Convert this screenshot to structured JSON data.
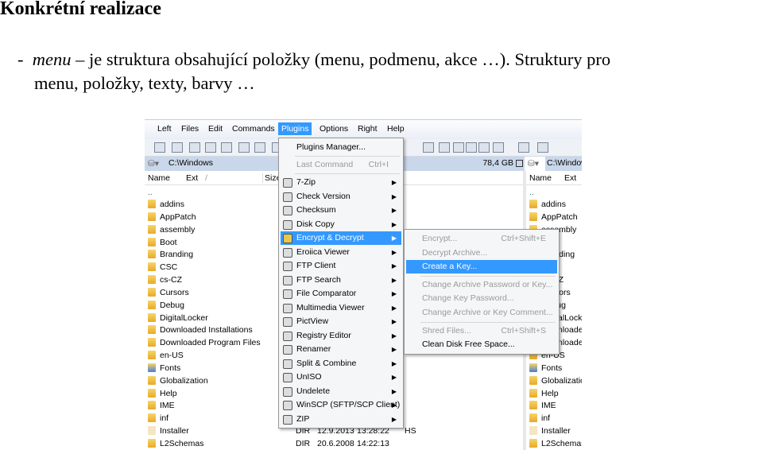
{
  "slide": {
    "title": "Konkrétní realizace",
    "bullet_dash": "-",
    "term": "menu",
    "line1_rest": " – je struktura obsahující položky (menu, podmenu, akce …). Struktury pro",
    "line2": "menu, položky, texty, barvy …"
  },
  "app": {
    "menubar": [
      "Left",
      "Files",
      "Edit",
      "Commands",
      "Plugins",
      "Options",
      "Right",
      "Help"
    ],
    "active_menu": "Plugins",
    "left_path": "C:\\Windows",
    "free_space": "78,4 GB",
    "right_path": "C:\\Windows",
    "columns": [
      "Name",
      "Ext",
      "Size"
    ],
    "right_columns": [
      "Name",
      "Ext"
    ],
    "up_dir": "..",
    "files": [
      "addins",
      "AppPatch",
      "assembly",
      "Boot",
      "Branding",
      "CSC",
      "cs-CZ",
      "Cursors",
      "Debug",
      "DigitalLocker",
      "Downloaded Installations",
      "Downloaded Program Files",
      "en-US",
      "Fonts",
      "Globalization",
      "Help",
      "IME",
      "inf",
      "Installer",
      "L2Schemas"
    ],
    "details": [
      {
        "name": "Installer",
        "type": "DIR",
        "date": "12.9.2013",
        "time": "13:28:22",
        "attr": "HS"
      },
      {
        "name": "L2Schemas",
        "type": "DIR",
        "date": "20.6.2008",
        "time": "14:22:13",
        "attr": ""
      }
    ],
    "highlight_color": "#3399ff",
    "plugins_menu": {
      "top": [
        {
          "label": "Plugins Manager...",
          "enabled": true
        },
        {
          "label": "Last Command",
          "shortcut": "Ctrl+I",
          "enabled": false
        }
      ],
      "items": [
        {
          "label": "7-Zip",
          "icon": "7zip-icon"
        },
        {
          "label": "Check Version",
          "icon": "check-version-icon"
        },
        {
          "label": "Checksum",
          "icon": "checksum-icon"
        },
        {
          "label": "Disk Copy",
          "icon": "disk-copy-icon"
        },
        {
          "label": "Encrypt & Decrypt",
          "icon": "lock-icon",
          "highlighted": true
        },
        {
          "label": "Eroiica Viewer",
          "icon": "viewer-icon"
        },
        {
          "label": "FTP Client",
          "icon": "ftp-client-icon"
        },
        {
          "label": "FTP Search",
          "icon": "ftp-search-icon"
        },
        {
          "label": "File Comparator",
          "icon": "file-compare-icon"
        },
        {
          "label": "Multimedia Viewer",
          "icon": "multimedia-icon"
        },
        {
          "label": "PictView",
          "icon": "picture-icon"
        },
        {
          "label": "Registry Editor",
          "icon": "registry-icon"
        },
        {
          "label": "Renamer",
          "icon": "renamer-icon"
        },
        {
          "label": "Split & Combine",
          "icon": "split-icon"
        },
        {
          "label": "UnISO",
          "icon": "disc-icon"
        },
        {
          "label": "Undelete",
          "icon": "undelete-icon"
        },
        {
          "label": "WinSCP (SFTP/SCP Client)",
          "icon": "winscp-icon"
        },
        {
          "label": "ZIP",
          "icon": "zip-icon"
        }
      ]
    },
    "encrypt_submenu": [
      {
        "label": "Encrypt...",
        "shortcut": "Ctrl+Shift+E",
        "enabled": false
      },
      {
        "label": "Decrypt Archive...",
        "enabled": false
      },
      {
        "label": "Create a Key...",
        "enabled": true,
        "highlighted": true
      },
      {
        "sep": true
      },
      {
        "label": "Change Archive Password or Key...",
        "enabled": false
      },
      {
        "label": "Change Key Password...",
        "enabled": false
      },
      {
        "label": "Change Archive or Key Comment...",
        "enabled": false
      },
      {
        "sep": true
      },
      {
        "label": "Shred Files...",
        "shortcut": "Ctrl+Shift+S",
        "enabled": false
      },
      {
        "label": "Clean Disk Free Space...",
        "enabled": true
      }
    ]
  }
}
